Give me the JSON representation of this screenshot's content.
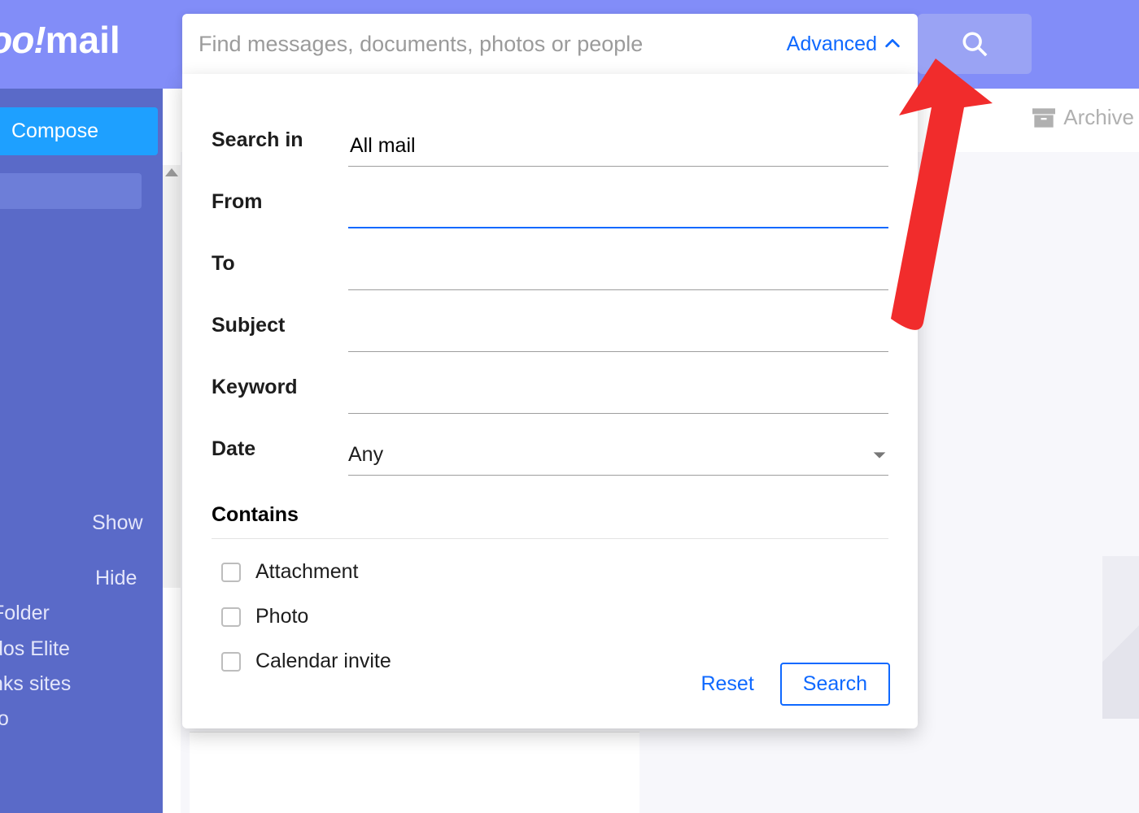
{
  "brand": {
    "part1": "hoo!",
    "part2": "mail"
  },
  "search": {
    "placeholder": "Find messages, documents, photos or people",
    "advanced_label": "Advanced"
  },
  "toolbar": {
    "archive_label": "Archive"
  },
  "sidebar": {
    "compose_label": "Compose",
    "show_label": "Show",
    "hide_label": "Hide",
    "folders": [
      "Folder",
      "dos Elite",
      "nks sites",
      "to",
      ""
    ]
  },
  "adv": {
    "labels": {
      "search_in": "Search in",
      "from": "From",
      "to": "To",
      "subject": "Subject",
      "keyword": "Keyword",
      "date": "Date",
      "contains": "Contains"
    },
    "search_in_value": "All mail",
    "from_value": "",
    "to_value": "",
    "subject_value": "",
    "keyword_value": "",
    "date_value": "Any",
    "contains_options": {
      "attachment": "Attachment",
      "photo": "Photo",
      "calendar": "Calendar invite"
    },
    "reset_label": "Reset",
    "search_label": "Search"
  }
}
